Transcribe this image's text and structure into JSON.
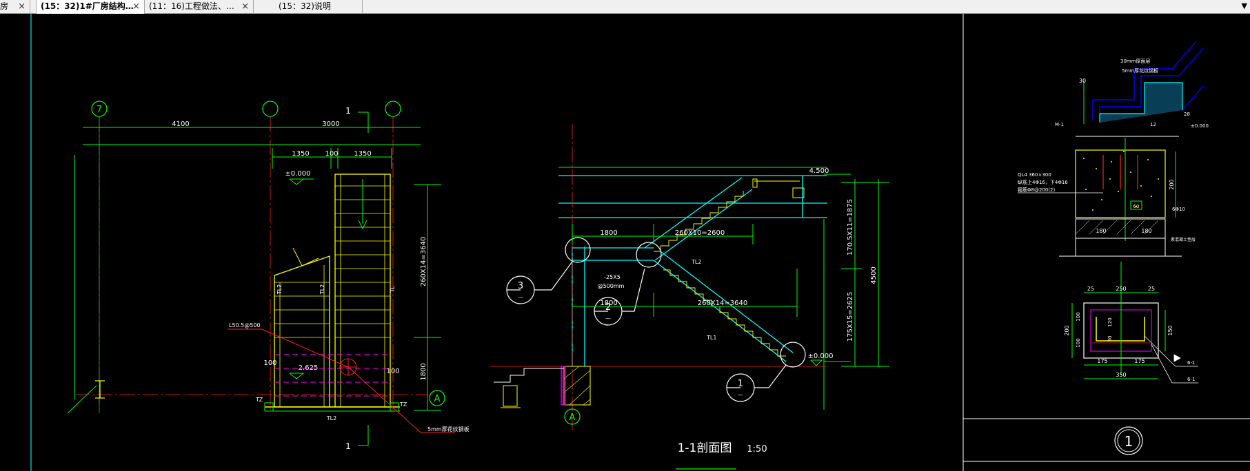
{
  "tabs": [
    {
      "label": "房",
      "active": false
    },
    {
      "label": "(15：32)1#厂房结构…",
      "active": true
    },
    {
      "label": "(11：16)工程做法、…",
      "active": false
    },
    {
      "label": "(15：32)说明",
      "active": false
    }
  ],
  "icons": {
    "close": "close-icon",
    "menu": "chevron-down-icon"
  },
  "close_glyph": "×",
  "menu_glyph": "▼",
  "plan": {
    "grid_7": "7",
    "grid_A": "A",
    "section_mark": "1",
    "dim_4100": "4100",
    "dim_3000": "3000",
    "dim_1350a": "1350",
    "dim_100": "100",
    "dim_1350b": "1350",
    "elev_0": "±0.000",
    "elev_2625": "2.625",
    "dim_run": "260X14=3640",
    "dim_1800": "1800",
    "dim_side_100a": "100",
    "dim_side_100b": "100",
    "label_tl_a": "TL2",
    "label_tl_b": "TL2",
    "label_tl_c": "TL",
    "label_tz_a": "TZ",
    "label_tz_b": "TZ",
    "label_tl_bottom": "TL2",
    "label_rebar": "L50.5@500",
    "label_plate": "5mm厚花纹钢板"
  },
  "section": {
    "elev_top": "4.500",
    "elev_bottom": "±0.000",
    "dim_1800a": "1800",
    "dim_step_top": "260X10=2600",
    "dim_1800b": "1800",
    "dim_step_bottom": "260X14=3640",
    "dim_v_top": "170.5X11=1875",
    "dim_v_bottom": "175X15=2625",
    "dim_total": "4500",
    "label_tl1": "TL1",
    "label_tl2": "TL2",
    "label_pipe": "-25X5",
    "label_spacing": "@500mm",
    "callout_1": "1",
    "callout_2": "2",
    "callout_3": "3",
    "callout_dash": "—",
    "grid_A": "A",
    "title": "1-1剖面图",
    "scale": "1:50"
  },
  "detail": {
    "top_note1": "30mm厚面层",
    "top_note2": "5mm厚花纹钢板",
    "dim_30": "30",
    "label_m1": "M-1",
    "label_12": "12",
    "label_28": "28",
    "elev_0": "±0.000",
    "beam_note1": "QL4 360×300",
    "beam_note2": "纵筋上4Φ16，下4Φ16",
    "beam_note3": "箍筋Φ8@200(2)",
    "dim_200": "200",
    "dim_180a": "180",
    "dim_180b": "180",
    "label_60": "60",
    "label_6phi10": "6Φ10",
    "base_note": "素混凝土垫层",
    "dim_25a": "25",
    "dim_250": "250",
    "dim_25b": "25",
    "dim_120": "120",
    "dim_30b": "30",
    "dim_150": "150",
    "dim_100a": "100",
    "dim_100b": "100",
    "dim_200b": "200",
    "dim_175a": "175",
    "dim_175b": "175",
    "dim_350": "350",
    "label_61a": "6-1",
    "label_61b": "6-1",
    "detail_number": "1"
  },
  "colors": {
    "cad_background": "#000000",
    "dimension_green": "#00ff00",
    "stair_yellow": "#ffff00",
    "section_cyan": "#00ffff",
    "axis_red": "#ff0000",
    "grid_white": "#ffffff",
    "hatch_magenta": "#ff00ff",
    "sheet_blue": "#0000ff",
    "tabbar_gray": "#f0f0f0"
  }
}
